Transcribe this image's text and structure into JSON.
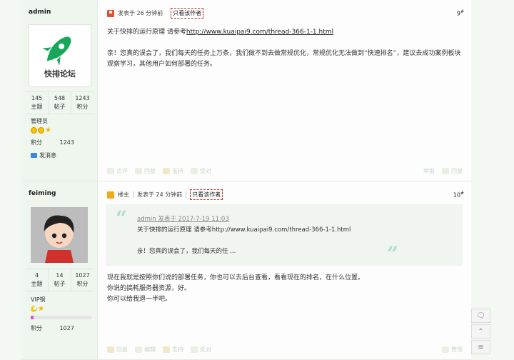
{
  "posts": [
    {
      "floor_num": "9",
      "floor_sup": "#",
      "author": {
        "name": "admin",
        "avatar_logo_text": "快排论坛",
        "stats": [
          {
            "value": "145",
            "label": "主题"
          },
          {
            "value": "548",
            "label": "帖子"
          },
          {
            "value": "1243",
            "label": "积分"
          }
        ],
        "group": "管理员",
        "points_label": "积分",
        "points_value": "1243",
        "message_link": "发消息"
      },
      "posted_at": "发表于 26 分钟前",
      "only_author": "只看该作者",
      "content_lead": "关于快排的运行原理 请参考",
      "content_link": "http://www.kuaipai9.com/thread-366-1-1.html",
      "content_body": "亲！您真的误会了，我们每天的任务上万条，我们做不到去做常规优化，常规优化无法做到“快速排名”，建议去成功案例板块观察学习，其他用户如何部署的任务。",
      "actions": [
        "点评",
        "回复",
        "支持",
        "反对"
      ],
      "actions_right": [
        "举报",
        "回复"
      ]
    },
    {
      "floor_num": "10",
      "floor_sup": "#",
      "author": {
        "name": "feiming",
        "stats": [
          {
            "value": "4",
            "label": "主题"
          },
          {
            "value": "14",
            "label": "帖子"
          },
          {
            "value": "1027",
            "label": "积分"
          }
        ],
        "group": "VIP铜",
        "level_progress": 0.05,
        "points_label": "积分",
        "points_value": "1027"
      },
      "host_label": "楼主",
      "posted_at": "发表于 24 分钟前",
      "only_author": "只看该作者",
      "quote": {
        "head": "admin 发表于 2017-7-19 11:03",
        "line1": "关于快排的运行原理 请参考http://www.kuaipai9.com/thread-366-1-1.html",
        "line2": "亲！您真的误会了，我们每天的任 ..."
      },
      "reply_lines": [
        "现在我就是按照你们说的部署任务，你也可以去后台查看，看看现在的排名，在什么位置。",
        "你说的搞耗服务器资源，好。",
        "你可以给我退一半吧。"
      ],
      "actions": [
        "回复",
        "编辑",
        "支持",
        "反对"
      ],
      "actions_right": [
        "管理"
      ]
    }
  ],
  "tools": [
    "comment-icon",
    "top-icon",
    "list-icon"
  ]
}
